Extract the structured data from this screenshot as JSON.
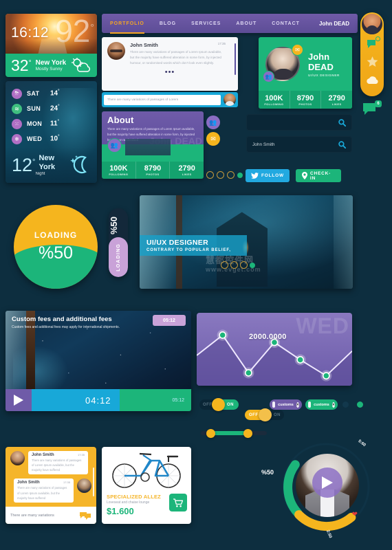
{
  "weather_day": {
    "time": "16:12",
    "big_temp": "92",
    "degree": "°",
    "temp": "32",
    "city": "New York",
    "condition": "Mostly Sunny",
    "icon": "sun-cloud-icon"
  },
  "weather_night": {
    "forecast": [
      {
        "day": "SAT",
        "value": "14",
        "icon": "storm-icon"
      },
      {
        "day": "SUN",
        "value": "24",
        "icon": "wind-icon"
      },
      {
        "day": "MON",
        "value": "11",
        "icon": "rain-icon"
      },
      {
        "day": "WED",
        "value": "10",
        "icon": "snow-icon"
      }
    ],
    "temp": "12",
    "degree": "°",
    "city": "New York",
    "condition": "Night",
    "icon": "moon-icon"
  },
  "navbar": {
    "items": [
      {
        "label": "PORTFOLIO",
        "active": true
      },
      {
        "label": "BLOG",
        "active": false
      },
      {
        "label": "SERVICES",
        "active": false
      },
      {
        "label": "ABOUT",
        "active": false
      },
      {
        "label": "CONTACT",
        "active": false
      }
    ],
    "user": "John DEAD"
  },
  "dock": {
    "avatar_name": "dock-avatar",
    "items": [
      "chat-icon",
      "star-icon",
      "cloud-icon"
    ],
    "chat_badge": "6"
  },
  "chat_card": {
    "name": "John Smith",
    "time": "17:35",
    "text": "There are many variations of passages of Lorem Ipsum available, but the majority have suffered alteration in some form, by injected humour, or randomised words which don't look even slightly.",
    "dots": "•••",
    "input_value": "There are many variations of passages of Lorem"
  },
  "about_card": {
    "title": "About",
    "text": "There are many variations of passages of Lorem Ipsum available, but the majority have suffered alteration in some form, by injected humour, or randomised",
    "ghost": "John DEAD",
    "stats": [
      {
        "num": "100K",
        "label": "FOLLOWING"
      },
      {
        "num": "8790",
        "label": "PHOTOS"
      },
      {
        "num": "2790",
        "label": "LIKES"
      }
    ]
  },
  "profile_card": {
    "name": "John DEAD",
    "role": "UI/UX DESIGNER",
    "stats": [
      {
        "num": "100K",
        "label": "FOLLOWING"
      },
      {
        "num": "8790",
        "label": "PHOTOS"
      },
      {
        "num": "2790",
        "label": "LIKES"
      }
    ]
  },
  "search": {
    "empty_placeholder": "",
    "filled_value": "John Smith",
    "icon": "search-icon"
  },
  "buttons": {
    "follow": "FOLLOW",
    "follow_icon": "twitter-icon",
    "checkin": "CHECK-IN",
    "checkin_icon": "location-pin-icon"
  },
  "loading_donut": {
    "label": "LOADING",
    "percent": "%50",
    "fill_color": "#1cb57a",
    "track_color": "#f5b51e"
  },
  "vertical_loader": {
    "percent": "%50",
    "label": "LOADING",
    "fill_color": "#c9a2d8"
  },
  "hero": {
    "title": "UI/UX DESIGNER",
    "subtitle": "CONTRARY TO POPULAR BELIEF,",
    "watermark": "慧都控件网",
    "watermark_sub": "www.evget.com"
  },
  "video_card": {
    "title": "Custom fees and additional fees",
    "subtitle": "Custom fees and additional fees may apply for international shipments.",
    "badge_time": "05:12",
    "current_time": "04:12",
    "total_time": "05:12",
    "play_icon": "play-icon"
  },
  "chart_data": {
    "type": "line",
    "title": "",
    "watermark": "WED",
    "annotation": "2000.0000",
    "x": [
      0,
      1,
      2,
      3,
      4,
      5,
      6
    ],
    "values": [
      1300,
      2000,
      700,
      1750,
      1150,
      600,
      1450
    ],
    "ylim": [
      400,
      2200
    ],
    "grid": false,
    "legend": "none",
    "point_color": "#1cb57a",
    "line_color": "#efe8ff",
    "bg_color": "#7a68b5"
  },
  "controls": {
    "toggle_on": {
      "off_label": "OFF",
      "on_label": "ON",
      "state": "on"
    },
    "toggle_off": {
      "off_label": "OFF",
      "on_label": "ON",
      "state": "off"
    },
    "pill_purple": {
      "label": "customs",
      "close": "✕"
    },
    "pill_green": {
      "label": "customs",
      "close": "✕"
    },
    "slider": {
      "min_handle": "handle-left",
      "max_handle": "handle-right"
    }
  },
  "chat_yellow": {
    "messages": [
      {
        "name": "John Smith",
        "time": "17:35",
        "text": "There are many variations of passages of Lorem Ipsum available, but the majority have suffered"
      },
      {
        "name": "John Smith",
        "time": "17:35",
        "text": "There are many variations of passages of Lorem Ipsum available, but the majority have suffered"
      }
    ],
    "footer_placeholder": "There are many variations",
    "footer_icon": "chat-bubble-icon"
  },
  "product_card": {
    "title": "SPECIALIZED ALLEZ",
    "subtitle": "Loveseat and chaise lounge",
    "price": "$1.600",
    "cart_icon": "cart-icon",
    "image_name": "bicycle-image"
  },
  "circular_player": {
    "percent": "%50",
    "time_top": "5:60",
    "time_bottom": "2:50",
    "play_icon": "play-icon",
    "heart_icon": "heart-icon",
    "green_color": "#1cb57a",
    "yellow_color": "#f5b51e"
  },
  "dots_indicator": {
    "count": 4,
    "active_index": 3
  }
}
